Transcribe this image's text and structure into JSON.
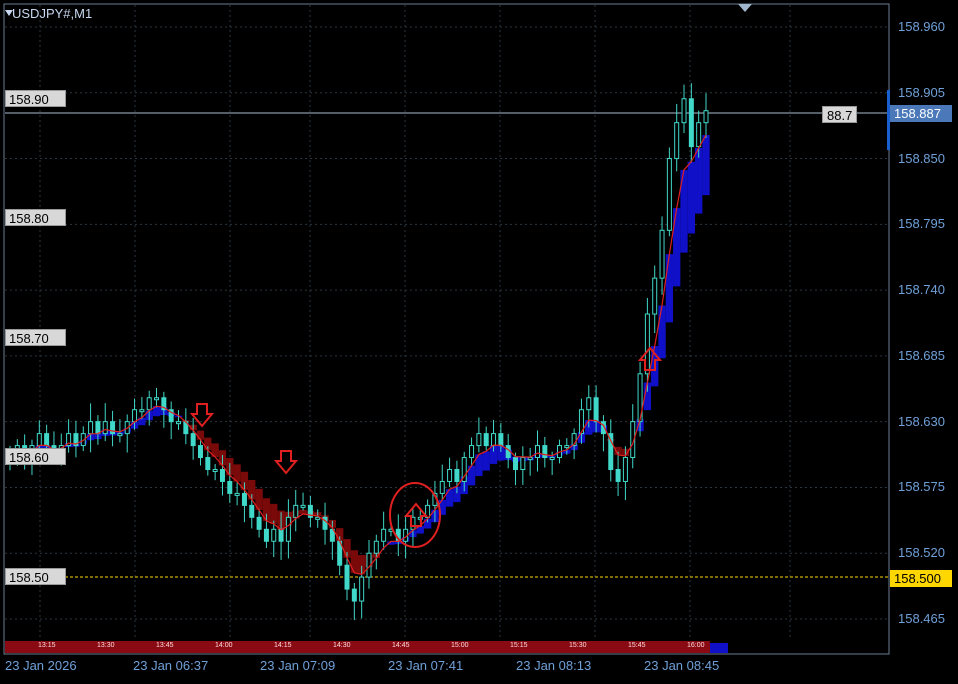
{
  "window": {
    "symbol_title": "USDJPY#,M1"
  },
  "price_axis": {
    "ticks": [
      "158.960",
      "158.905",
      "158.850",
      "158.795",
      "158.740",
      "158.685",
      "158.630",
      "158.575",
      "158.520",
      "158.465"
    ],
    "current_price": "158.887",
    "level_price": "158.500"
  },
  "value_label": "88.7",
  "level_labels": [
    "158.90",
    "158.80",
    "158.70",
    "158.60",
    "158.50"
  ],
  "time_axis": {
    "labels": [
      "23 Jan 2026",
      "23 Jan 06:37",
      "23 Jan 07:09",
      "23 Jan 07:41",
      "23 Jan 08:13",
      "23 Jan 08:45"
    ],
    "mini_labels": [
      "13:15",
      "13:30",
      "13:45",
      "14:00",
      "14:15",
      "14:30",
      "14:45",
      "15:00",
      "15:15",
      "15:30",
      "15:45",
      "16:00"
    ]
  },
  "colors": {
    "background": "#000000",
    "grid": "#2a3640",
    "axis_text": "#6fa0d8",
    "candle": "#40d8c8",
    "ribbon_up": "#1010c8",
    "ribbon_down": "#7a0a0a",
    "ma_line": "#e02020",
    "arrow": "#e02020",
    "level_line": "#ffd700",
    "current_line": "#aabbcc"
  },
  "icons": [
    "sell-arrow-icon",
    "sell-arrow-icon",
    "buy-arrow-icon",
    "buy-arrow-icon"
  ],
  "chart_data": {
    "type": "candlestick",
    "title": "USDJPY#,M1",
    "ylim": [
      158.44,
      158.99
    ],
    "y_ticks": [
      158.96,
      158.905,
      158.85,
      158.795,
      158.74,
      158.685,
      158.63,
      158.575,
      158.52,
      158.465
    ],
    "current_price": 158.887,
    "horizontal_level": 158.5,
    "x_labels": [
      "23 Jan 2026",
      "23 Jan 06:37",
      "23 Jan 07:09",
      "23 Jan 07:41",
      "23 Jan 08:13",
      "23 Jan 08:45"
    ],
    "close_series": [
      158.6,
      158.61,
      158.6,
      158.61,
      158.62,
      158.61,
      158.6,
      158.61,
      158.62,
      158.61,
      158.62,
      158.63,
      158.62,
      158.63,
      158.62,
      158.62,
      158.63,
      158.64,
      158.64,
      158.65,
      158.65,
      158.64,
      158.63,
      158.63,
      158.62,
      158.61,
      158.6,
      158.59,
      158.59,
      158.58,
      158.57,
      158.57,
      158.56,
      158.55,
      158.54,
      158.53,
      158.54,
      158.53,
      158.55,
      158.56,
      158.56,
      158.55,
      158.55,
      158.54,
      158.53,
      158.51,
      158.49,
      158.48,
      158.5,
      158.52,
      158.53,
      158.54,
      158.54,
      158.53,
      158.54,
      158.55,
      158.55,
      158.56,
      158.57,
      158.58,
      158.59,
      158.58,
      158.6,
      158.61,
      158.62,
      158.61,
      158.62,
      158.61,
      158.6,
      158.59,
      158.6,
      158.6,
      158.61,
      158.6,
      158.6,
      158.61,
      158.61,
      158.62,
      158.64,
      158.65,
      158.63,
      158.62,
      158.59,
      158.58,
      158.6,
      158.63,
      158.67,
      158.72,
      158.75,
      158.79,
      158.85,
      158.88,
      158.9,
      158.86,
      158.88,
      158.89
    ]
  }
}
